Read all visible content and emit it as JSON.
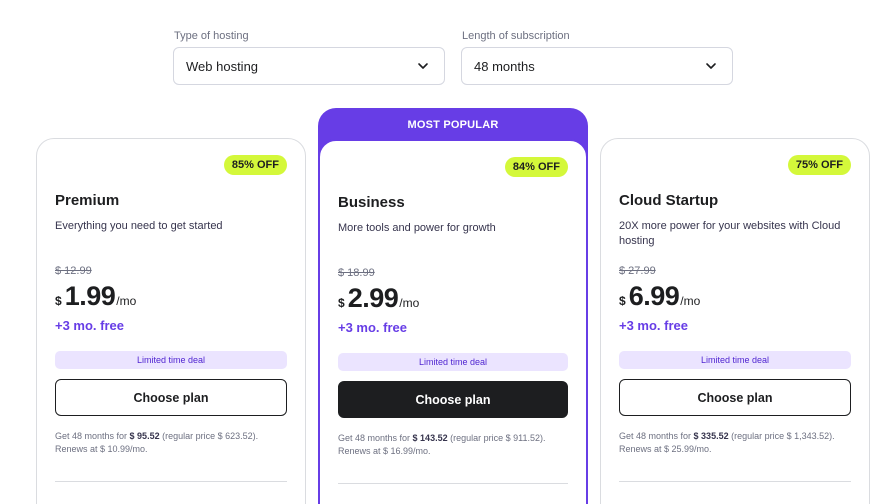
{
  "filters": {
    "hosting": {
      "label": "Type of hosting",
      "value": "Web hosting"
    },
    "length": {
      "label": "Length of subscription",
      "value": "48 months"
    }
  },
  "popular_label": "MOST POPULAR",
  "plans": [
    {
      "badge": "85% OFF",
      "name": "Premium",
      "description": "Everything you need to get started",
      "old_price": "$ 12.99",
      "currency": "$",
      "price": "1.99",
      "per": "/mo",
      "free": "+3 mo. free",
      "deal": "Limited time deal",
      "cta": "Choose plan",
      "fine_prefix": "Get 48 months for ",
      "fine_total": "$ 95.52",
      "fine_suffix": " (regular price $ 623.52). Renews at $ 10.99/mo."
    },
    {
      "badge": "84% OFF",
      "name": "Business",
      "description": "More tools and power for growth",
      "old_price": "$ 18.99",
      "currency": "$",
      "price": "2.99",
      "per": "/mo",
      "free": "+3 mo. free",
      "deal": "Limited time deal",
      "cta": "Choose plan",
      "fine_prefix": "Get 48 months for ",
      "fine_total": "$ 143.52",
      "fine_suffix": " (regular price $ 911.52). Renews at $ 16.99/mo."
    },
    {
      "badge": "75% OFF",
      "name": "Cloud Startup",
      "description": "20X more power for your websites with Cloud hosting",
      "old_price": "$ 27.99",
      "currency": "$",
      "price": "6.99",
      "per": "/mo",
      "free": "+3 mo. free",
      "deal": "Limited time deal",
      "cta": "Choose plan",
      "fine_prefix": "Get 48 months for ",
      "fine_total": "$ 335.52",
      "fine_suffix": " (regular price $ 1,343.52). Renews at $ 25.99/mo."
    }
  ],
  "colors": {
    "accent": "#673de6",
    "badge": "#d4f83a",
    "deal_bg": "#ebe4ff",
    "dark_button": "#1d1e20"
  }
}
